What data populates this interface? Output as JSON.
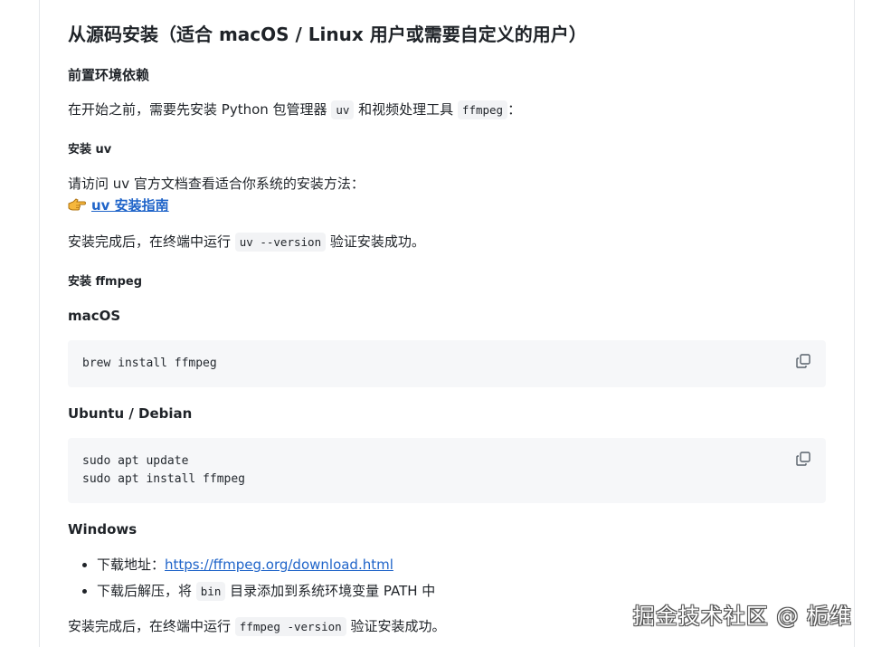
{
  "title": "从源码安装（适合 macOS / Linux 用户或需要自定义的用户）",
  "prereq": {
    "heading": "前置环境依赖",
    "intro_before": "在开始之前，需要先安装 Python 包管理器 ",
    "intro_code1": "uv",
    "intro_middle": " 和视频处理工具 ",
    "intro_code2": "ffmpeg",
    "intro_after": "："
  },
  "install_uv": {
    "heading": "安装 uv",
    "text": "请访问 uv 官方文档查看适合你系统的安装方法：",
    "guide_icon": "pointing-hand-icon",
    "guide_link": "uv 安装指南",
    "verify_before": "安装完成后，在终端中运行 ",
    "verify_code": "uv --version",
    "verify_after": " 验证安装成功。"
  },
  "install_ffmpeg": {
    "heading": "安装 ffmpeg",
    "macos": {
      "heading": "macOS",
      "code": "brew install ffmpeg"
    },
    "ubuntu": {
      "heading": "Ubuntu / Debian",
      "code": "sudo apt update\nsudo apt install ffmpeg"
    },
    "windows": {
      "heading": "Windows",
      "item1_label": "下载地址：",
      "item1_link": "https://ffmpeg.org/download.html",
      "item2_before": "下载后解压，将 ",
      "item2_code": "bin",
      "item2_after": " 目录添加到系统环境变量 PATH 中"
    },
    "verify_before": "安装完成后，在终端中运行 ",
    "verify_code": "ffmpeg -version",
    "verify_after": " 验证安装成功。"
  },
  "copy_icon": "copy-icon",
  "watermark": "掘金技术社区 @ 栀维"
}
